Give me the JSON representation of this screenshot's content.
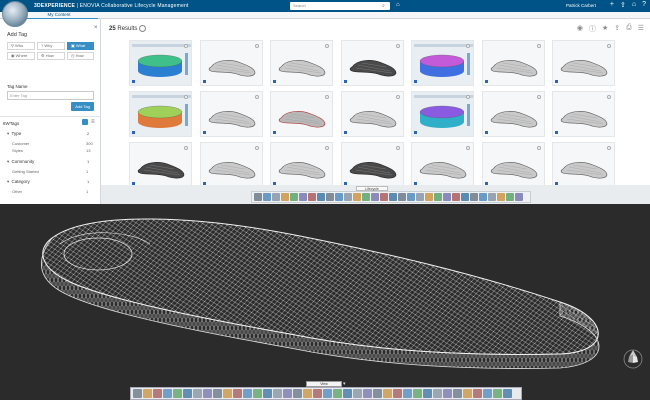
{
  "topbar": {
    "brand_bold": "3DEXPERIENCE",
    "brand_rest": " | ENOVIA  Collaborative Lifecycle Management",
    "search_placeholder": "Search",
    "user_name": "Patrick Carbert",
    "icons": [
      "plus-icon",
      "share-icon",
      "home-icon",
      "help-icon"
    ]
  },
  "subbar": {
    "tab": "My Content"
  },
  "left_panel": {
    "title": "Add Tag",
    "tag_types": [
      {
        "label": "Who",
        "active": false
      },
      {
        "label": "Why",
        "active": false
      },
      {
        "label": "What",
        "active": true
      },
      {
        "label": "Where",
        "active": false
      },
      {
        "label": "How",
        "active": false
      },
      {
        "label": "How",
        "active": false
      }
    ],
    "tag_name_label": "Tag Name",
    "tag_name_placeholder": "Enter Tag",
    "add_button": "Add Tag",
    "sixw_label": "6WTags",
    "facets": [
      {
        "name": "Type",
        "count": "2",
        "values": [
          {
            "label": "Customer",
            "count": "300"
          },
          {
            "label": "Styles",
            "count": "13"
          }
        ]
      },
      {
        "name": "Community",
        "count": "1",
        "values": [
          {
            "label": "Getting Started",
            "count": "1"
          }
        ]
      },
      {
        "name": "Category",
        "count": "1",
        "values": [
          {
            "label": "Other",
            "count": "1"
          }
        ]
      }
    ]
  },
  "results": {
    "count": "25",
    "label": "Results",
    "tools": [
      "eye-icon",
      "info-icon",
      "star-icon",
      "share-icon",
      "print-icon",
      "view-toggle-icon"
    ]
  },
  "toolbar_tab": "Lifecycle",
  "bottom_toolbar_tab": "View",
  "thumbnails": [
    {
      "kind": "disk-color"
    },
    {
      "kind": "sole"
    },
    {
      "kind": "sole"
    },
    {
      "kind": "sole-dark"
    },
    {
      "kind": "disk-purple"
    },
    {
      "kind": "sole"
    },
    {
      "kind": "sole"
    },
    {
      "kind": "disk-heat"
    },
    {
      "kind": "sole"
    },
    {
      "kind": "sole-red"
    },
    {
      "kind": "sole"
    },
    {
      "kind": "disk-purple2"
    },
    {
      "kind": "sole"
    },
    {
      "kind": "sole"
    },
    {
      "kind": "sole-dark"
    },
    {
      "kind": "sole"
    },
    {
      "kind": "sole"
    },
    {
      "kind": "sole-dark"
    },
    {
      "kind": "sole"
    },
    {
      "kind": "sole"
    },
    {
      "kind": "sole"
    }
  ],
  "colors": {
    "topbar": "#005386",
    "accent": "#368ec4",
    "viewport_bg": "#2b2b2b",
    "lattice": "#d8d8d8"
  }
}
